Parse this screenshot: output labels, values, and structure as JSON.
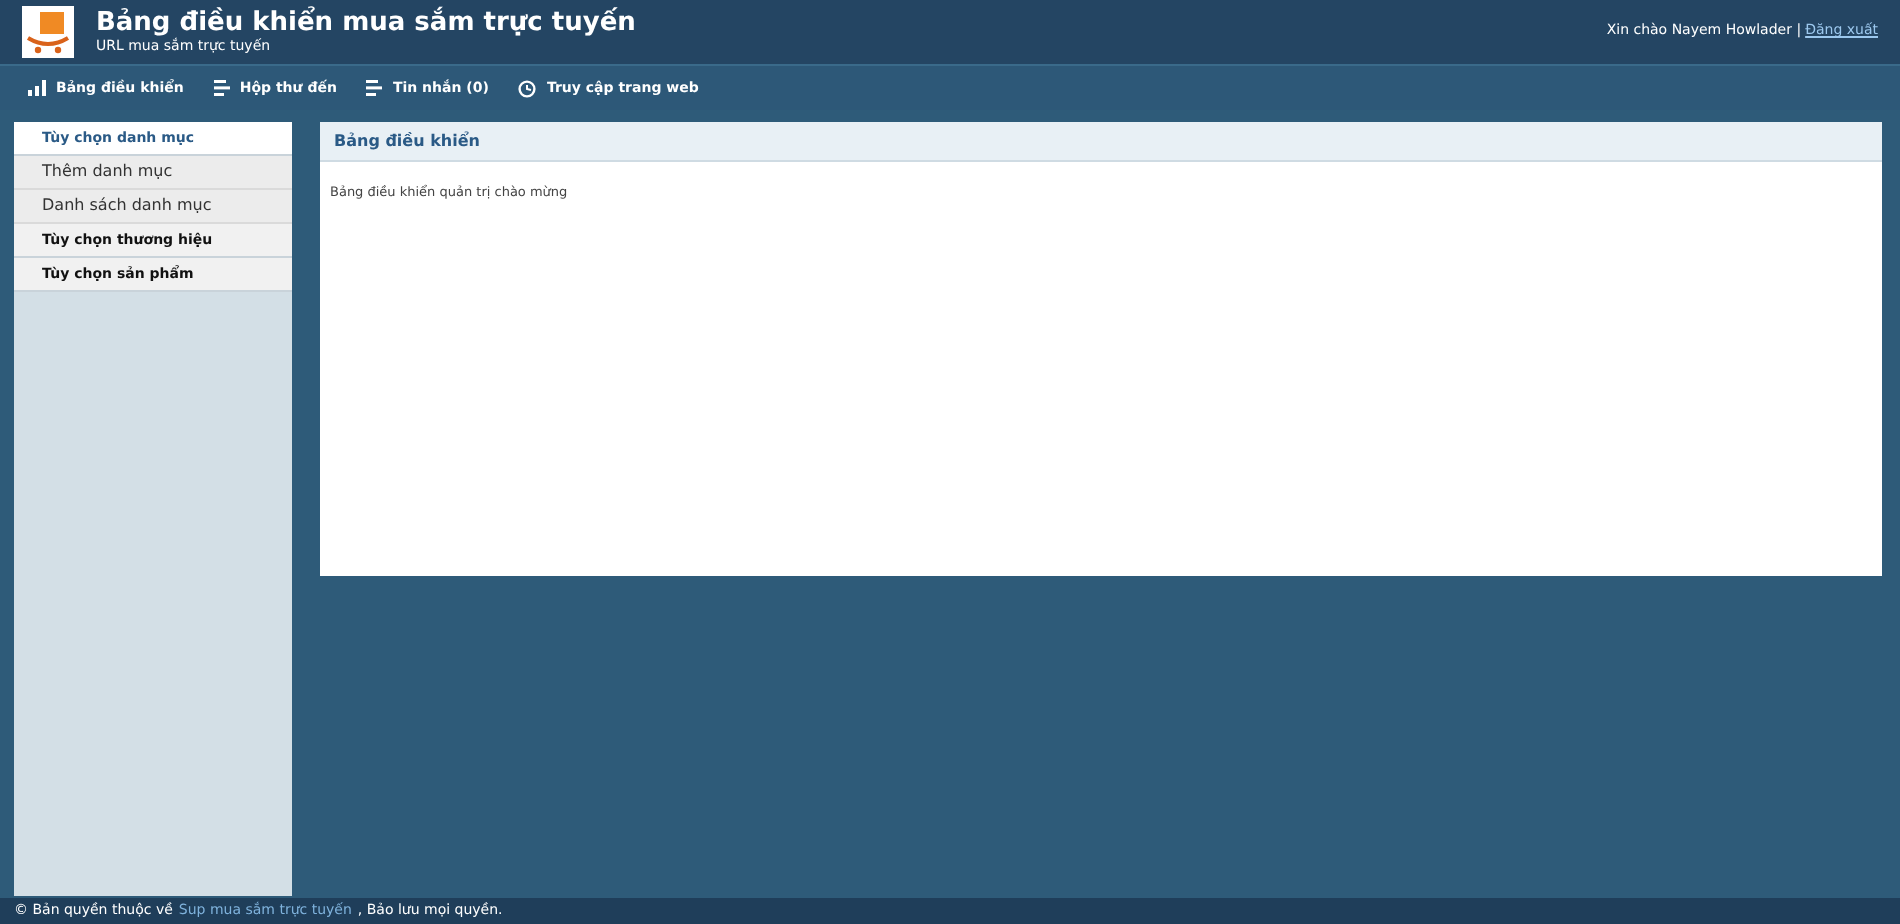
{
  "header": {
    "title": "Bảng điều khiển mua sắm trực tuyến",
    "subtitle": "URL mua sắm trực tuyến",
    "greeting": "Xin chào Nayem Howlader |",
    "logout": "Đăng xuất"
  },
  "nav": [
    {
      "label": "Bảng điều khiển",
      "kind": "stats"
    },
    {
      "label": "Hộp thư đến",
      "kind": "list"
    },
    {
      "label": "Tin nhắn (0)",
      "kind": "list"
    },
    {
      "label": "Truy cập trang web",
      "kind": "visit"
    }
  ],
  "sidebar": {
    "items": [
      {
        "label": "Tùy chọn danh mục",
        "kind": "heading",
        "selected": true,
        "children": [
          {
            "label": "Thêm danh mục"
          },
          {
            "label": "Danh sách danh mục"
          }
        ]
      },
      {
        "label": "Tùy chọn thương hiệu",
        "kind": "heading",
        "selected": false
      },
      {
        "label": "Tùy chọn sản phẩm",
        "kind": "heading",
        "selected": false
      }
    ]
  },
  "panel": {
    "title": "Bảng điều khiển",
    "body": "Bảng điều khiển quản trị chào mừng"
  },
  "footer": {
    "prefix": "© Bản quyền thuộc về",
    "link": "Sup mua sắm trực tuyến",
    "suffix": ", Bảo lưu mọi quyền."
  }
}
